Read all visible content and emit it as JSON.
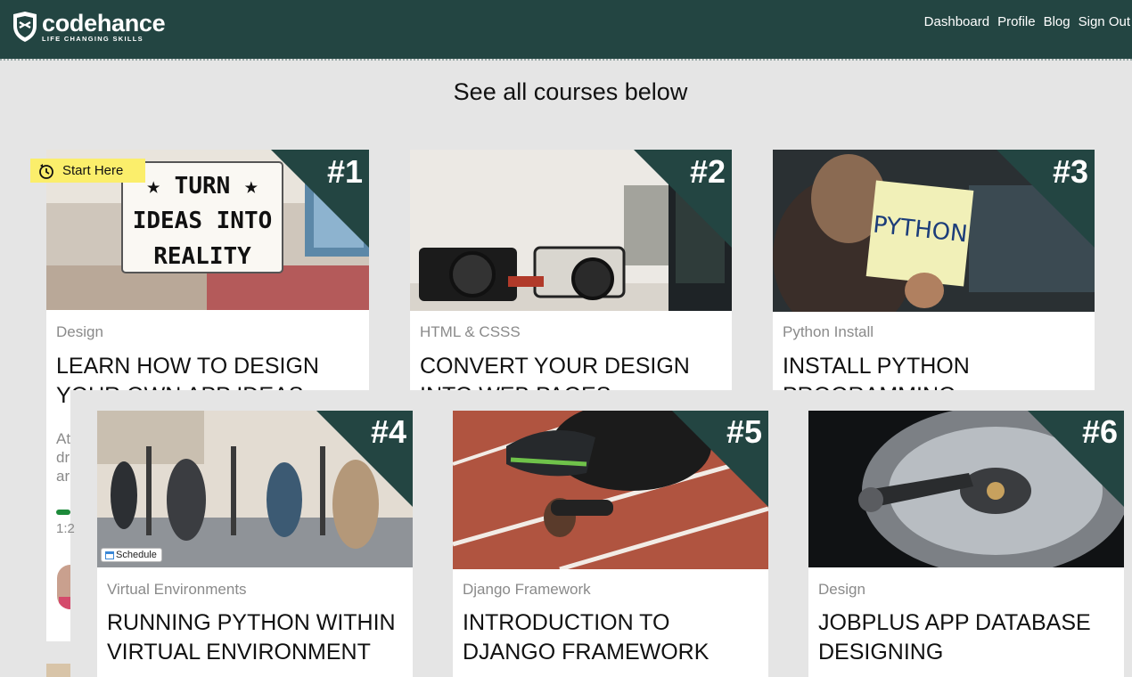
{
  "brand": {
    "name": "codehance",
    "tagline": "LIFE CHANGING SKILLS"
  },
  "nav": [
    "Dashboard",
    "Profile",
    "Blog",
    "Sign Out"
  ],
  "heading": "See all courses below",
  "colors": {
    "header": "#234542",
    "ribbon": "#234542",
    "badge": "#fbee6b",
    "progress": "#1d8a3a"
  },
  "badge": {
    "label": "Start Here",
    "icon": "clock-arrow-icon"
  },
  "schedule": {
    "label": "Schedule",
    "icon": "calendar-icon"
  },
  "courses": [
    {
      "number": "#1",
      "category": "Design",
      "title": "LEARN HOW TO DESIGN YOUR OWN APP IDEAS",
      "image": "light-box-sign-turn-ideas-into-reality"
    },
    {
      "number": "#2",
      "category": "HTML & CSSS",
      "title": "CONVERT YOUR DESIGN INTO WEB PAGES",
      "image": "cameras-on-desk"
    },
    {
      "number": "#3",
      "category": "Python Install",
      "title": "INSTALL PYTHON PROGRAMMING LANGUAGE",
      "image": "man-holding-python-note"
    },
    {
      "number": "#4",
      "category": "Virtual Environments",
      "title": "RUNNING PYTHON WITHIN VIRTUAL ENVIRONMENT",
      "image": "people-in-vr-headsets"
    },
    {
      "number": "#5",
      "category": "Django Framework",
      "title": "INTRODUCTION TO DJANGO FRAMEWORK",
      "image": "sprinter-at-start-line"
    },
    {
      "number": "#6",
      "category": "Design",
      "title": "JOBPLUS APP DATABASE DESIGNING",
      "image": "hard-drive-platter"
    }
  ],
  "lightbox_text": [
    "★ TURN ★",
    "IDEAS INTO",
    "REALITY"
  ],
  "python_note": "PYTHON",
  "peek": {
    "desc_fragments": [
      "At",
      "dr",
      "ar"
    ],
    "time_fragment": "1:2",
    "progress_fraction": 0.1
  }
}
